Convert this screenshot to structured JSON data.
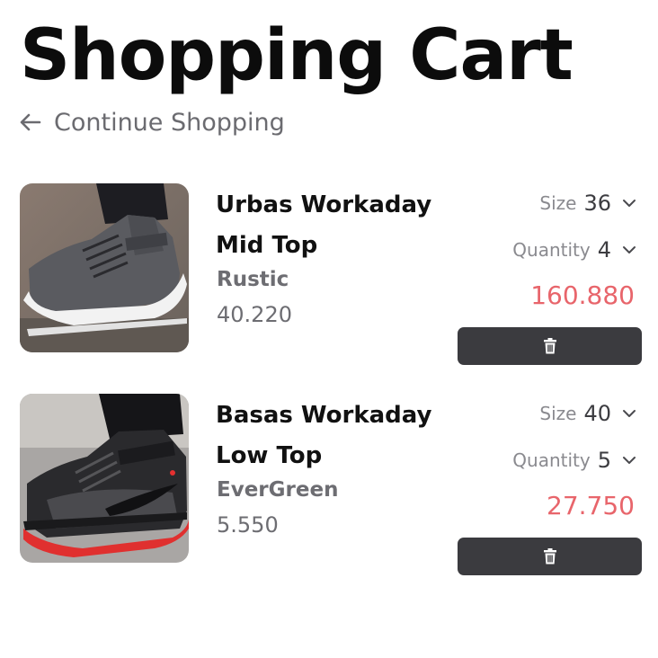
{
  "header": {
    "title": "Shopping Cart",
    "continue_label": "Continue Shopping",
    "continue_icon": "arrow-left-icon"
  },
  "colors": {
    "accent_price": "#e8656b",
    "delete_button": "#3b3b3f",
    "muted_text": "#6d6d72"
  },
  "items": [
    {
      "name": "Urbas Workaday Mid Top",
      "brand": "Rustic",
      "price": "40.220",
      "size_label": "Size",
      "size_value": "36",
      "quantity_label": "Quantity",
      "quantity_value": "4",
      "total": "160.880",
      "delete_icon": "trash-icon"
    },
    {
      "name": "Basas Workaday Low Top",
      "brand": "EverGreen",
      "price": "5.550",
      "size_label": "Size",
      "size_value": "40",
      "quantity_label": "Quantity",
      "quantity_value": "5",
      "total": "27.750",
      "delete_icon": "trash-icon"
    }
  ]
}
